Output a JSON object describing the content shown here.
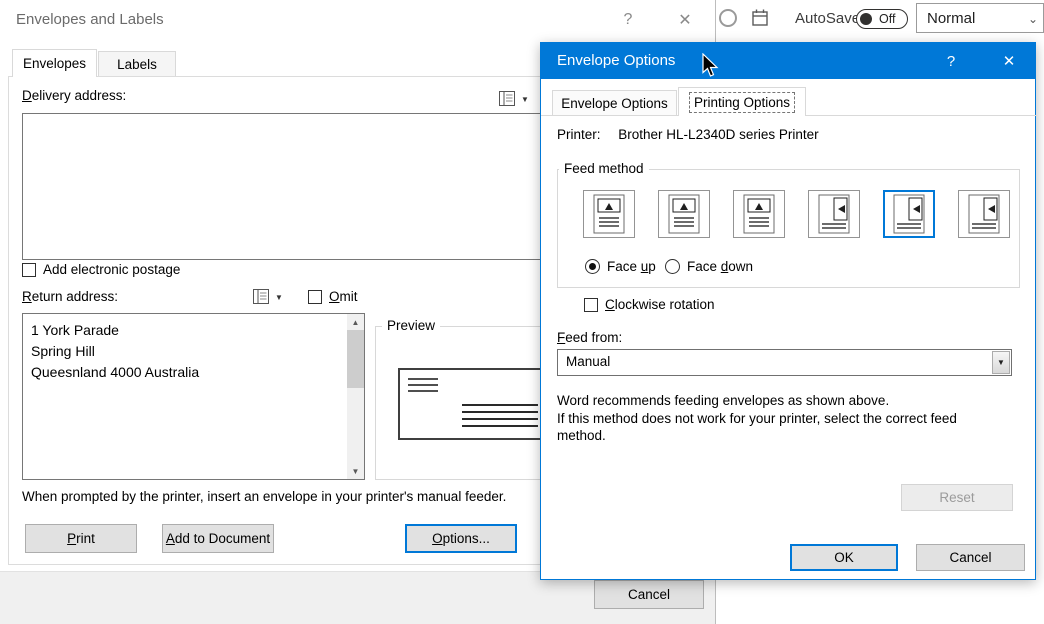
{
  "accent": "#0078d7",
  "icons": {
    "dropdown_arrow": "▼",
    "scroll_up": "▲",
    "scroll_down": "▼",
    "chevron_down": "⌄"
  },
  "ribbon": {
    "autosave_label": "AutoSave",
    "autosave_state": "Off",
    "style_value": "Normal"
  },
  "envelopes_dialog": {
    "title": "Envelopes and Labels",
    "help_glyph": "?",
    "close_glyph": "✕",
    "tab_envelopes": "Envelopes",
    "tab_labels": "Labels",
    "delivery_label": {
      "text": "Delivery address:",
      "u": 0
    },
    "electronic_postage_label": "Add electronic postage",
    "electronic_postage_checked": false,
    "return_label": {
      "text": "Return address:",
      "u": 0
    },
    "omit_label": {
      "text": "Omit",
      "u": 0
    },
    "omit_checked": false,
    "return_address_lines": [
      "1 York Parade",
      "Spring Hill",
      "Queesnland 4000 Australia"
    ],
    "preview_label": "Preview",
    "instruction": "When prompted by the printer, insert an envelope in your printer's manual feeder.",
    "print_button": {
      "text": "Print",
      "u": 0
    },
    "add_to_document_button": {
      "text": "Add to Document",
      "u": 0
    },
    "options_button": {
      "text": "Options...",
      "u": 0
    },
    "cancel_button": "Cancel"
  },
  "envelope_options_dialog": {
    "title": "Envelope Options",
    "help_glyph": "?",
    "close_glyph": "✕",
    "tab_envelope_options": "Envelope Options",
    "tab_printing_options": "Printing Options",
    "selected_tab": "Printing Options",
    "printer_label": "Printer:",
    "printer_value": "Brother HL-L2340D series Printer",
    "feed_method_label": "Feed method",
    "feed_methods": {
      "options": [
        "feed-horizontal-left",
        "feed-horizontal-center",
        "feed-horizontal-right",
        "feed-vertical-left",
        "feed-vertical-center",
        "feed-vertical-right"
      ],
      "selected_index": 4
    },
    "face_up_label": {
      "text": "Face up",
      "u": 5
    },
    "face_up_checked": true,
    "face_down_label": {
      "text": "Face down",
      "u": 5
    },
    "face_down_checked": false,
    "clockwise_label": {
      "text": "Clockwise rotation",
      "u": 0
    },
    "clockwise_checked": false,
    "feed_from_label": {
      "text": "Feed from:",
      "u": 0
    },
    "feed_from_value": "Manual",
    "recommendation_lines": [
      "Word recommends feeding envelopes as shown above.",
      "If this method does not work for your printer, select the correct feed",
      "method."
    ],
    "reset_button": "Reset",
    "reset_enabled": false,
    "ok_button": "OK",
    "cancel_button": "Cancel"
  }
}
